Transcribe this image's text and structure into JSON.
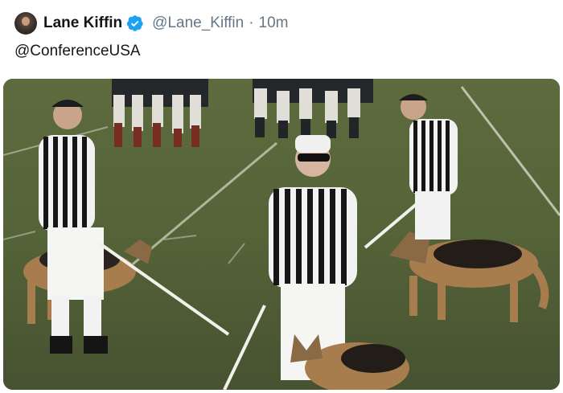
{
  "tweet": {
    "author_name": "Lane Kiffin",
    "handle": "@Lane_Kiffin",
    "separator": "·",
    "timestamp": "10m",
    "text": "@ConferenceUSA"
  },
  "icons": {
    "verified": "verified-badge-icon",
    "avatar": "profile-avatar"
  },
  "colors": {
    "verified_blue": "#1da1f2",
    "secondary_text": "#657786",
    "primary_text": "#14171a",
    "field_green": "#4d5a34"
  }
}
